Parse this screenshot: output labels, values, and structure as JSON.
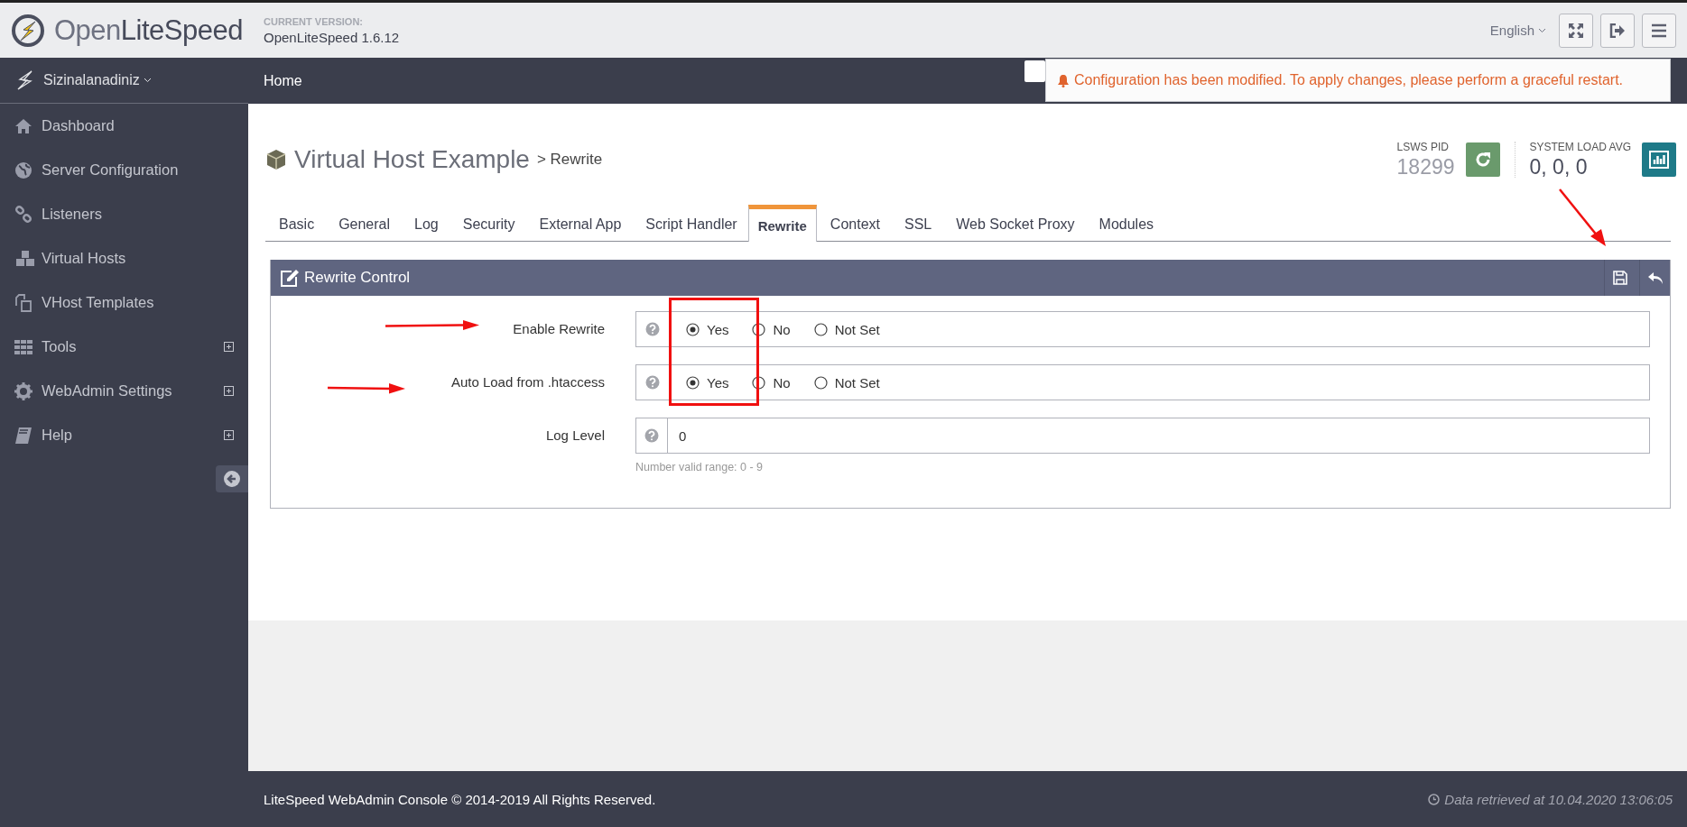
{
  "header": {
    "logo": "Open**LiteSpeed**",
    "version_label": "CURRENT VERSION:",
    "version": "OpenLiteSpeed 1.6.12",
    "language": "English"
  },
  "nav": {
    "server": "Sizinalanadiniz",
    "breadcrumb": "Home"
  },
  "notification": {
    "text": "Configuration has been modified. To apply changes, please perform a graceful restart."
  },
  "sidebar": {
    "items": [
      {
        "label": "Dashboard",
        "expandable": false
      },
      {
        "label": "Server Configuration",
        "expandable": false
      },
      {
        "label": "Listeners",
        "expandable": false
      },
      {
        "label": "Virtual Hosts",
        "expandable": false
      },
      {
        "label": "VHost Templates",
        "expandable": false
      },
      {
        "label": "Tools",
        "expandable": true
      },
      {
        "label": "WebAdmin Settings",
        "expandable": true
      },
      {
        "label": "Help",
        "expandable": true
      }
    ]
  },
  "page": {
    "title": "Virtual Host Example",
    "subtitle": "> Rewrite",
    "pid_label": "LSWS PID",
    "pid": "18299",
    "load_label": "SYSTEM LOAD AVG",
    "load": "0, 0, 0"
  },
  "tabs": [
    {
      "label": "Basic",
      "selected": false
    },
    {
      "label": "General",
      "selected": false
    },
    {
      "label": "Log",
      "selected": false
    },
    {
      "label": "Security",
      "selected": false
    },
    {
      "label": "External App",
      "selected": false
    },
    {
      "label": "Script Handler",
      "selected": false
    },
    {
      "label": "Rewrite",
      "selected": true
    },
    {
      "label": "Context",
      "selected": false
    },
    {
      "label": "SSL",
      "selected": false
    },
    {
      "label": "Web Socket Proxy",
      "selected": false
    },
    {
      "label": "Modules",
      "selected": false
    }
  ],
  "panel": {
    "title": "Rewrite Control",
    "fields": [
      {
        "kind": "radio",
        "label": "Enable Rewrite",
        "options": [
          {
            "label": "Yes",
            "selected": true
          },
          {
            "label": "No",
            "selected": false
          },
          {
            "label": "Not Set",
            "selected": false
          }
        ]
      },
      {
        "kind": "radio",
        "label": "Auto Load from .htaccess",
        "options": [
          {
            "label": "Yes",
            "selected": true
          },
          {
            "label": "No",
            "selected": false
          },
          {
            "label": "Not Set",
            "selected": false
          }
        ]
      },
      {
        "kind": "text",
        "label": "Log Level",
        "value": "0",
        "hint": "Number valid range: 0 - 9"
      }
    ]
  },
  "footer": {
    "copyright": "LiteSpeed WebAdmin Console © 2014-2019 All Rights Reserved.",
    "retrieved": "Data retrieved at 10.04.2020 13:06:05"
  }
}
